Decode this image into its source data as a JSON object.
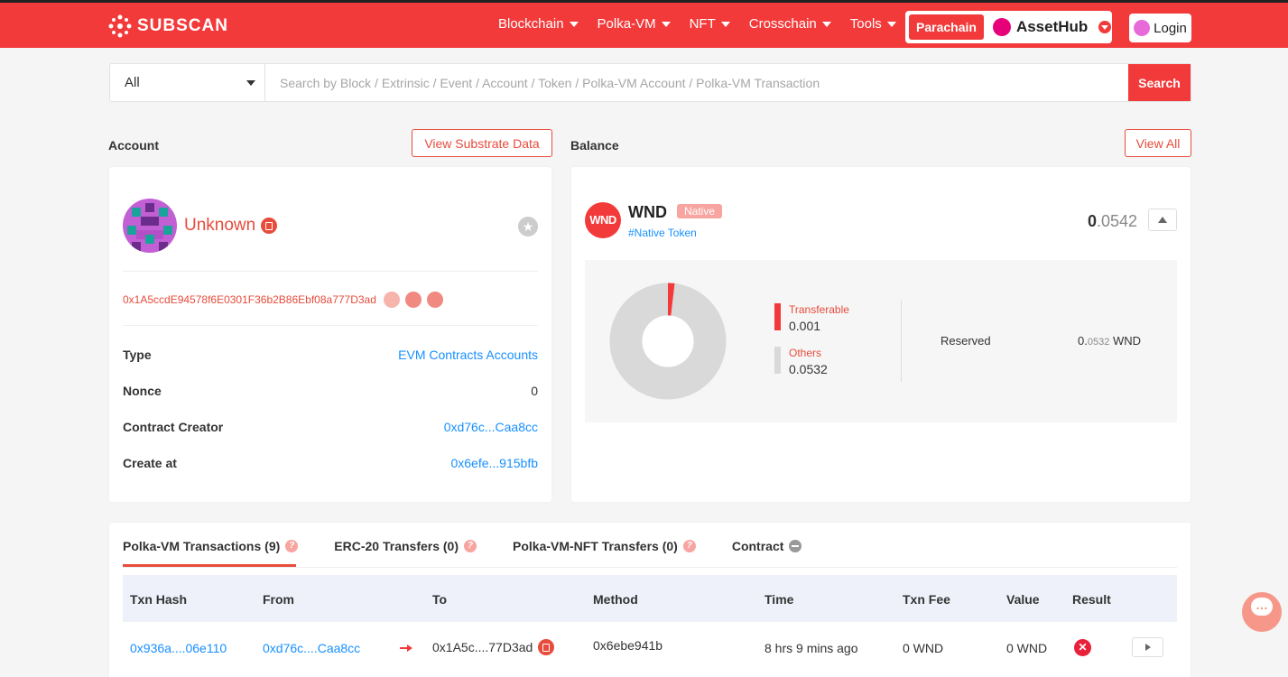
{
  "brand": {
    "name": "SUBSCAN"
  },
  "nav": {
    "items": [
      {
        "label": "Blockchain"
      },
      {
        "label": "Polka-VM"
      },
      {
        "label": "NFT"
      },
      {
        "label": "Crosschain"
      },
      {
        "label": "Tools"
      }
    ],
    "chain_tag": "Parachain",
    "chain_name": "AssetHub",
    "login": "Login"
  },
  "search": {
    "type_value": "All",
    "placeholder": "Search by Block / Extrinsic / Event / Account / Token / Polka-VM Account / Polka-VM Transaction",
    "button": "Search"
  },
  "account": {
    "title": "Account",
    "view_substrate_btn": "View Substrate Data",
    "name": "Unknown",
    "address": "0x1A5ccdE94578f6E0301F36b2B86Ebf08a777D3ad",
    "rows": [
      {
        "key": "Type",
        "value": "EVM Contracts Accounts"
      },
      {
        "key": "Nonce",
        "value": "0"
      },
      {
        "key": "Contract Creator",
        "value": "0xd76c...Caa8cc"
      },
      {
        "key": "Create at",
        "value": "0x6efe...915bfb"
      }
    ]
  },
  "balance": {
    "title": "Balance",
    "view_all_btn": "View All",
    "token_logo": "WND",
    "token_symbol": "WND",
    "native_badge": "Native",
    "native_link": "#Native Token",
    "amount_int": "0",
    "amount_dec": ".0542",
    "transferable_label": "Transferable",
    "transferable_value": "0.001",
    "others_label": "Others",
    "others_value": "0.0532",
    "reserved_label": "Reserved",
    "reserved_int": "0.",
    "reserved_dec": "0532",
    "reserved_unit": "WND",
    "chart_fraction_transferable": 0.0185,
    "colors": {
      "transferable": "#f33a3a",
      "others": "#d9d9d9"
    }
  },
  "transactions": {
    "tabs": [
      {
        "label": "Polka-VM Transactions (9)"
      },
      {
        "label": "ERC-20 Transfers (0)"
      },
      {
        "label": "Polka-VM-NFT Transfers (0)"
      },
      {
        "label": "Contract"
      }
    ],
    "columns": [
      "Txn Hash",
      "From",
      "To",
      "Method",
      "Time",
      "Txn Fee",
      "Value",
      "Result"
    ],
    "rows": [
      {
        "hash": "0x936a....06e110",
        "from": "0xd76c....Caa8cc",
        "to": "0x1A5c....77D3ad",
        "method": "0x6ebe941b",
        "time": "8 hrs 9 mins ago",
        "fee": "0 WND",
        "value": "0 WND"
      }
    ]
  }
}
